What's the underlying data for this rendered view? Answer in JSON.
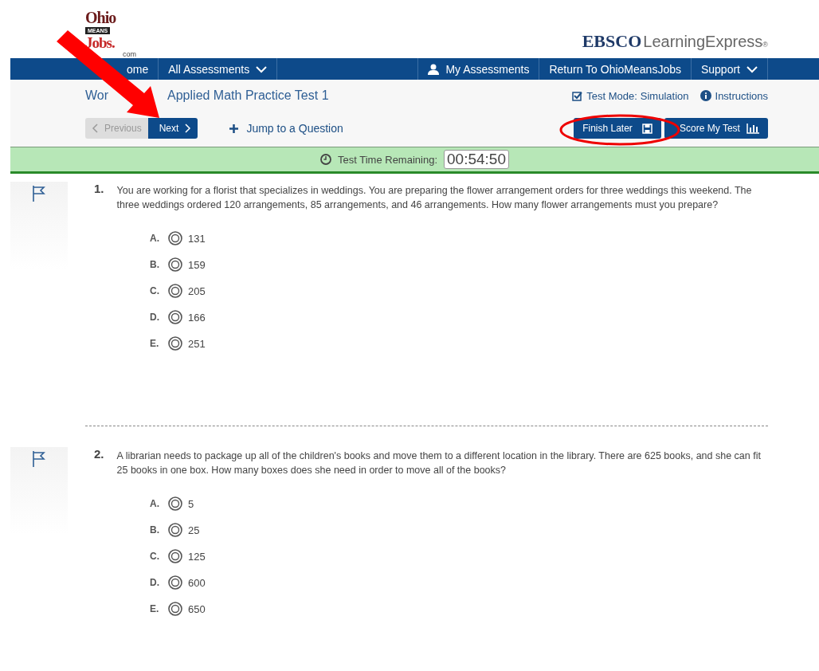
{
  "logo": {
    "top": "Ohio",
    "middle": "MEANS",
    "bottom": "Jobs.",
    "suffix": "com"
  },
  "brand": {
    "strong": "EBSCO",
    "light": "LearningExpress",
    "mark": "®"
  },
  "nav": [
    {
      "label": "ome",
      "kind": "link"
    },
    {
      "label": "All Assessments",
      "kind": "dropdown"
    },
    {
      "label": "My Assessments",
      "kind": "account"
    },
    {
      "label": "Return To OhioMeansJobs",
      "kind": "link"
    },
    {
      "label": "Support",
      "kind": "dropdown"
    }
  ],
  "test_title": {
    "visible_start": "Wor",
    "visible_end": "Applied Math Practice Test 1"
  },
  "test_mode": {
    "label": "Test Mode:",
    "value": "Simulation",
    "checked": true
  },
  "instructions": "Instructions",
  "pager": [
    {
      "label": "Previous",
      "disabled": true
    },
    {
      "label": "Next",
      "disabled": false
    }
  ],
  "jump": "Jump to a Question",
  "actions": [
    "Finish Later",
    "Score My Test"
  ],
  "timer": {
    "label": "Test Time Remaining:",
    "value": "00:54:50"
  },
  "questions": [
    {
      "number": "1.",
      "flagged": false,
      "text": "You are working for a florist that specializes in weddings. You are preparing the flower arrangement orders for three weddings this weekend. The three weddings ordered 120 arrangements, 85 arrangements, and 46 arrangements. How many flower arrangements must you prepare?",
      "options": [
        {
          "letter": "A.",
          "text": "131",
          "selected": false
        },
        {
          "letter": "B.",
          "text": "159",
          "selected": false
        },
        {
          "letter": "C.",
          "text": "205",
          "selected": false
        },
        {
          "letter": "D.",
          "text": "166",
          "selected": false
        },
        {
          "letter": "E.",
          "text": "251",
          "selected": false
        }
      ]
    },
    {
      "number": "2.",
      "flagged": false,
      "text": "A librarian needs to package up all of the children's books and move them to a different location in the library. There are 625 books, and she can fit 25 books in one box. How many boxes does she need in order to move all of the books?",
      "options": [
        {
          "letter": "A.",
          "text": "5",
          "selected": false
        },
        {
          "letter": "B.",
          "text": "25",
          "selected": false
        },
        {
          "letter": "C.",
          "text": "125",
          "selected": false
        },
        {
          "letter": "D.",
          "text": "600",
          "selected": false
        },
        {
          "letter": "E.",
          "text": "650",
          "selected": false
        }
      ]
    }
  ]
}
